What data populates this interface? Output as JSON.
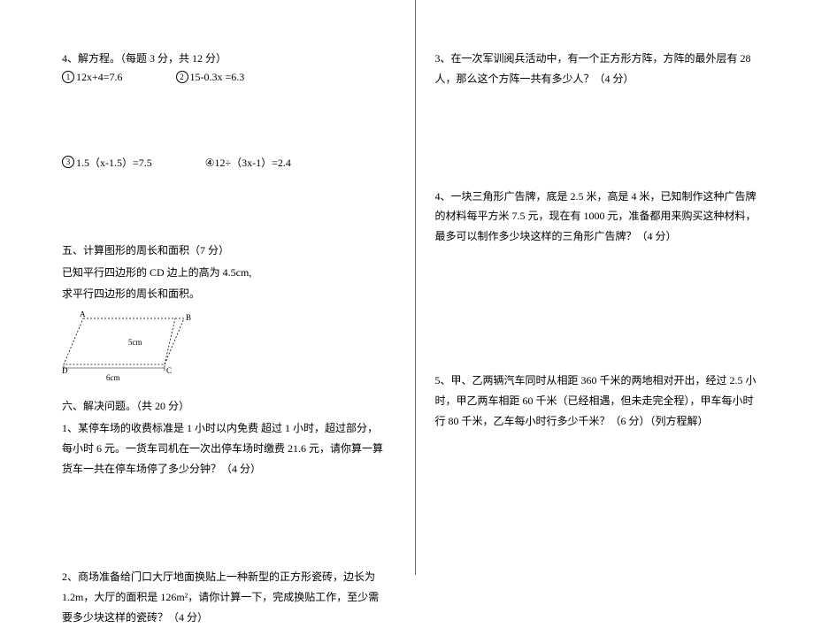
{
  "left": {
    "s4": {
      "title": "4、解方程。（每题 3 分，共 12 分）",
      "eq1": "12x+4=7.6",
      "eq2": "15-0.3x =6.3",
      "eq3": "1.5（x-1.5）=7.5",
      "eq4": "④12÷（3x-1）=2.4",
      "n1": "1",
      "n2": "2",
      "n3": "3"
    },
    "s5": {
      "title": "五、计算图形的周长和面积（7 分）",
      "l1": "已知平行四边形的 CD 边上的高为 4.5cm,",
      "l2": "求平行四边形的周长和面积。",
      "pts": {
        "A": "A",
        "B": "B",
        "C": "C",
        "D": "D"
      },
      "diag": {
        "side": "5cm",
        "base": "6cm"
      }
    },
    "s6": {
      "title": "六、解决问题。（共 20 分）",
      "q1": "1、某停车场的收费标准是 1 小时以内免费 超过 1 小时，超过部分，每小时 6 元。一货车司机在一次出停车场时缴费 21.6 元，请你算一算货车一共在停车场停了多少分钟？（4 分）",
      "q2": "2、商场准备给门口大厅地面换贴上一种新型的正方形瓷砖，边长为 1.2m，大厅的面积是 126m²，请你计算一下，完成换贴工作，至少需要多少块这样的瓷砖？（4 分）"
    }
  },
  "right": {
    "q3": "3、在一次军训阅兵活动中，有一个正方形方阵，方阵的最外层有 28 人，那么这个方阵一共有多少人？（4 分）",
    "q4": "4、一块三角形广告牌，底是 2.5 米，高是 4 米，已知制作这种广告牌的材料每平方米 7.5 元，现在有 1000 元，准备都用来购买这种材料，最多可以制作多少块这样的三角形广告牌？（4 分）",
    "q5": "5、甲、乙两辆汽车同时从相距 360 千米的两地相对开出，经过 2.5 小时，甲乙两车相距 60 千米（已经相遇，但未走完全程），甲车每小时行 80 千米，乙车每小时行多少千米？（6 分）（列方程解）"
  }
}
